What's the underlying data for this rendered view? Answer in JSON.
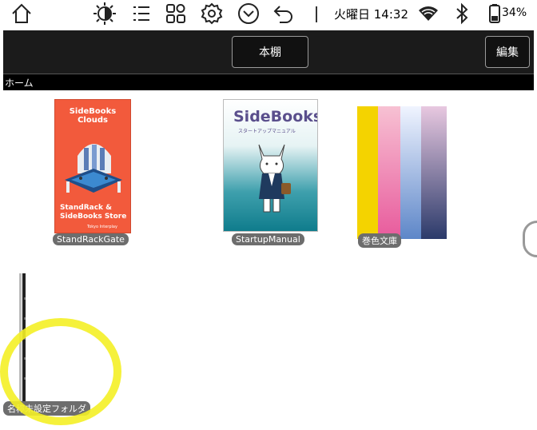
{
  "status_bar": {
    "icons": [
      "home-icon",
      "brightness-icon",
      "list-icon",
      "apps-icon",
      "settings-icon",
      "dropdown-icon",
      "back-icon",
      "wifi-icon",
      "bluetooth-icon",
      "battery-icon"
    ],
    "datetime": "火曜日 14:32",
    "battery": "34%"
  },
  "toolbar": {
    "shelf_label": "本棚",
    "edit_label": "編集"
  },
  "breadcrumb": "ホーム",
  "books": [
    {
      "caption": "StandRackGate",
      "cover_title": "SideBooks Clouds",
      "cover_subtitle_1": "StandRack &",
      "cover_subtitle_2": "SideBooks Store",
      "cover_author": "Tokyo Interplay"
    },
    {
      "caption": "StartupManual",
      "cover_title": "SideBooks",
      "cover_subtitle": "スタートアップマニュアル"
    },
    {
      "caption": "巻色文庫"
    }
  ],
  "folder": {
    "caption": "名称未設定フォルダ"
  },
  "colors": {
    "toolbar_bg": "#1b1b1b",
    "highlight": "#f4f026",
    "cover_orange": "#f25a3c"
  }
}
